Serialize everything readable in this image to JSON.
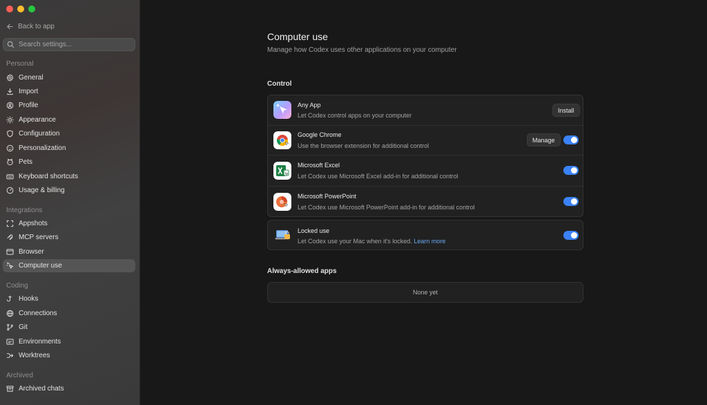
{
  "sidebar": {
    "back_label": "Back to app",
    "search_placeholder": "Search settings...",
    "sections": {
      "personal": "Personal",
      "integrations": "Integrations",
      "coding": "Coding",
      "archived": "Archived"
    },
    "items": {
      "general": "General",
      "import": "Import",
      "profile": "Profile",
      "appearance": "Appearance",
      "configuration": "Configuration",
      "personalization": "Personalization",
      "pets": "Pets",
      "keyboard_shortcuts": "Keyboard shortcuts",
      "usage_billing": "Usage & billing",
      "appshots": "Appshots",
      "mcp_servers": "MCP servers",
      "browser": "Browser",
      "computer_use": "Computer use",
      "hooks": "Hooks",
      "connections": "Connections",
      "git": "Git",
      "environments": "Environments",
      "worktrees": "Worktrees",
      "archived_chats": "Archived chats"
    },
    "active_item": "computer_use"
  },
  "main": {
    "title": "Computer use",
    "subtitle": "Manage how Codex uses other applications on your computer",
    "control_label": "Control",
    "apps": [
      {
        "name": "Any App",
        "description": "Let Codex control apps on your computer",
        "action": "Install"
      },
      {
        "name": "Google Chrome",
        "description": "Use the browser extension for additional control",
        "action": "Manage",
        "enabled": true
      },
      {
        "name": "Microsoft Excel",
        "description": "Let Codex use Microsoft Excel add-in for additional control",
        "enabled": true
      },
      {
        "name": "Microsoft PowerPoint",
        "description": "Let Codex use Microsoft PowerPoint add-in for additional control",
        "enabled": true
      }
    ],
    "locked": {
      "name": "Locked use",
      "description": "Let Codex use your Mac when it's locked.",
      "link": "Learn more",
      "enabled": true
    },
    "always_allowed_label": "Always-allowed apps",
    "always_allowed_empty": "None yet"
  },
  "colors": {
    "accent": "#3b82f6",
    "link": "#6aa8f0"
  }
}
